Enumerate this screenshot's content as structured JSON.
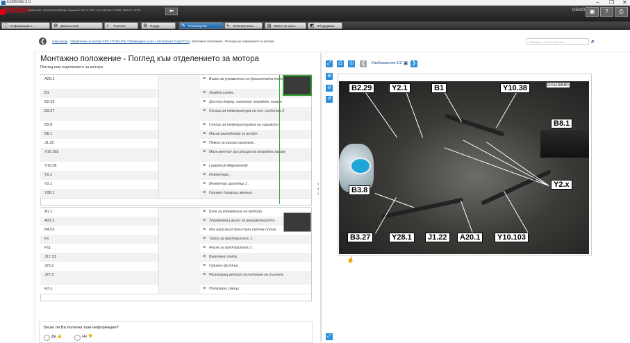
{
  "window": {
    "title": "ESItronic 2.0",
    "minimize": "–",
    "restore": "❐",
    "close": "✕"
  },
  "appbar": {
    "brand": "BOSCH",
    "vehicle": "VWW-4425 / VW (VOLKSWAGEN) / Passat 2.0 TDI CC / 2ST / 1.6 / 93,5 kW / Y-2008 - 05/2012 / CFFB",
    "demo": "DEMO"
  },
  "nav": {
    "tabs": [
      {
        "label": "Информация з...",
        "icon": "info-icon"
      },
      {
        "label": "Диагностика",
        "icon": "diagnostic-icon"
      },
      {
        "label": "Търсене",
        "icon": "search-icon"
      },
      {
        "label": "Поддр.",
        "icon": "gear-icon"
      },
      {
        "label": "Ръководства",
        "icon": "wrench-icon",
        "active": true
      },
      {
        "label": "Електрически ...",
        "icon": "lightning-icon"
      },
      {
        "label": "Известни греш...",
        "icon": "known-errors-icon"
      },
      {
        "label": "Оборудване",
        "icon": "equipment-icon"
      }
    ]
  },
  "breadcrumb": {
    "link1": "Наръчници",
    "sep1": " › ",
    "link2": "Управление на мотора  EDC 17C46-UDS / Привеждане ср-во с автоматика Старт/Стоп",
    "sep2": " › ",
    "current": "Монтажно положение · Поглед към отделението за мотора"
  },
  "search": {
    "placeholder": "Въведете за пълнотекстов..."
  },
  "page": {
    "title": "Монтажно положение - Поглед към отделението за мотора",
    "subtitle": "Поглед към отделението за мотора"
  },
  "groups": [
    {
      "rows": [
        {
          "code": "A20.1",
          "desc": "Възел за управление на дросселната клапа"
        },
        {
          "code": "B1",
          "desc": "Ламбда сонда ."
        },
        {
          "code": "B2.29",
          "desc": "Датчик.дифер. налягане отработ. газове ."
        },
        {
          "code": "B3.27",
          "desc": "Сензор за температура на охл. средство 2"
        },
        {
          "code": "B3.8",
          "desc": "Сензор за температурата на горивото ."
        },
        {
          "code": "B8.1",
          "desc": "Масов разходомер за въздух ."
        },
        {
          "code": "J1.22",
          "desc": "Помпа за високо налягане ."
        },
        {
          "code": "Y10.103",
          "desc": "Магн.вентил охл.рецирк.на отработ.газове"
        },
        {
          "code": "Y10.38",
          "desc": "Ladedruck-Magnetventil ."
        },
        {
          "code": "Y2.x",
          "desc": "Инжектори ."
        },
        {
          "code": "Y2.1",
          "desc": "Инжектор цилиндър 1 ."
        },
        {
          "code": "Y28.1",
          "desc": "Горивен дозиращ вентил ."
        }
      ]
    },
    {
      "rows": [
        {
          "code": "A1.1",
          "desc": "Блок за управление на мотора ."
        },
        {
          "code": "A22.2",
          "desc": "Управляващ възел за рециркулацията ."
        },
        {
          "code": "B4.53",
          "desc": "Рег.напр.възд.прен.пълн.датчик полож. ."
        },
        {
          "code": "F1",
          "desc": "Табло за предпазители 1 ."
        },
        {
          "code": "F11",
          "desc": "Носач за предпазители 1 ."
        },
        {
          "code": "J17.13",
          "desc": "Вакуумна помпа ."
        },
        {
          "code": "J23.2",
          "desc": "Горивен филтър ."
        },
        {
          "code": "J27.2",
          "desc": "Регулиращ вентил за налягане на пълнене"
        },
        {
          "code": "R3.x",
          "desc": "Подгревни свещи ."
        }
      ]
    }
  ],
  "viewer": {
    "counter": "Изображение 1/2",
    "doc_id": "DS108880",
    "labels": [
      "B2.29",
      "Y2.1",
      "B1",
      "Y10.38",
      "B8.1",
      "Y2.x",
      "B3.8",
      "B3.27",
      "Y28.1",
      "J1.22",
      "A20.1",
      "Y10.103"
    ]
  },
  "feedback": {
    "question": "Беше ли Ви полезна тази информация?",
    "yes": "Да",
    "no": "Не"
  }
}
